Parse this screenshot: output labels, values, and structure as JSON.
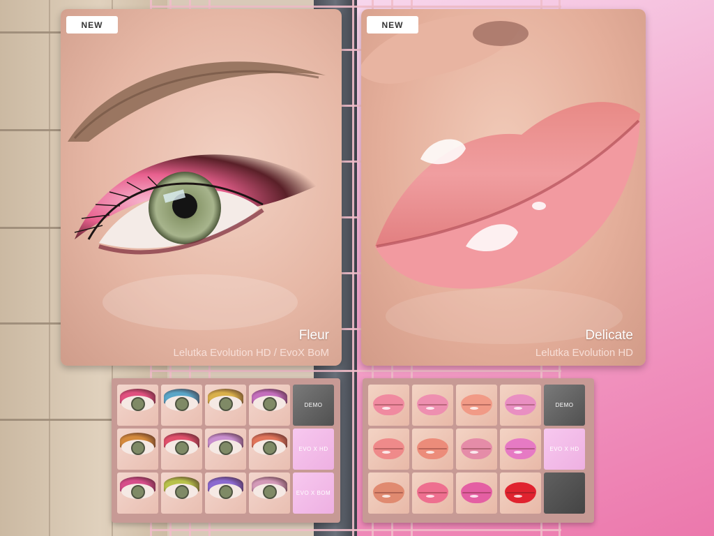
{
  "eye_card": {
    "badge": "NEW",
    "title": "Fleur",
    "subtitle": "Lelutka Evolution HD / EvoX BoM"
  },
  "lip_card": {
    "badge": "NEW",
    "title": "Delicate",
    "subtitle": "Lelutka Evolution HD"
  },
  "eye_panel": {
    "buttons": [
      "DEMO",
      "EVO X HD",
      "EVO X BOM"
    ],
    "swatch_colors": [
      "#e0507f",
      "#5aa6c8",
      "#d9b04a",
      "#c46fbd",
      "#d48a3d",
      "#e0506b",
      "#c98fcf",
      "#e0745a",
      "#d64d8a",
      "#b8c24a",
      "#8a6ad0",
      "#d39ab8"
    ]
  },
  "lip_panel": {
    "buttons": [
      "DEMO",
      "EVO X HD"
    ],
    "swatch_colors": [
      "#f08aa0",
      "#ee8fb0",
      "#f19a86",
      "#e98fc2",
      "#ef8a8a",
      "#ec8c7a",
      "#e58ca8",
      "#e67ac4",
      "#e08a70",
      "#ee6f8f",
      "#e45fa3",
      "#e0232f"
    ]
  }
}
